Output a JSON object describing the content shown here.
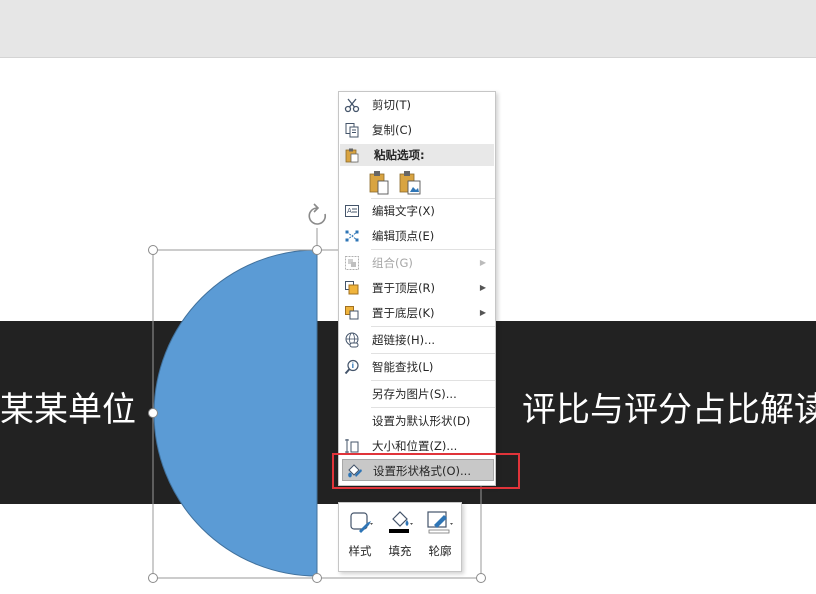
{
  "slide": {
    "left_text": "某某单位",
    "right_text": "评比与评分占比解读",
    "band_color": "#222222",
    "shape_fill": "#5b9bd5",
    "shape_stroke": "#41719c"
  },
  "context_menu": {
    "cut": "剪切(T)",
    "copy": "复制(C)",
    "paste_options": "粘贴选项:",
    "edit_text": "编辑文字(X)",
    "edit_points": "编辑顶点(E)",
    "group": "组合(G)",
    "bring_to_front": "置于顶层(R)",
    "send_to_back": "置于底层(K)",
    "hyperlink": "超链接(H)...",
    "smart_lookup": "智能查找(L)",
    "save_as_picture": "另存为图片(S)...",
    "set_default_shape": "设置为默认形状(D)",
    "size_position": "大小和位置(Z)...",
    "format_shape": "设置形状格式(O)..."
  },
  "mini_toolbar": {
    "style": "样式",
    "fill": "填充",
    "outline": "轮廓"
  },
  "colors": {
    "highlight_box": "#e0343a",
    "menu_hover": "#c8c8c8"
  }
}
